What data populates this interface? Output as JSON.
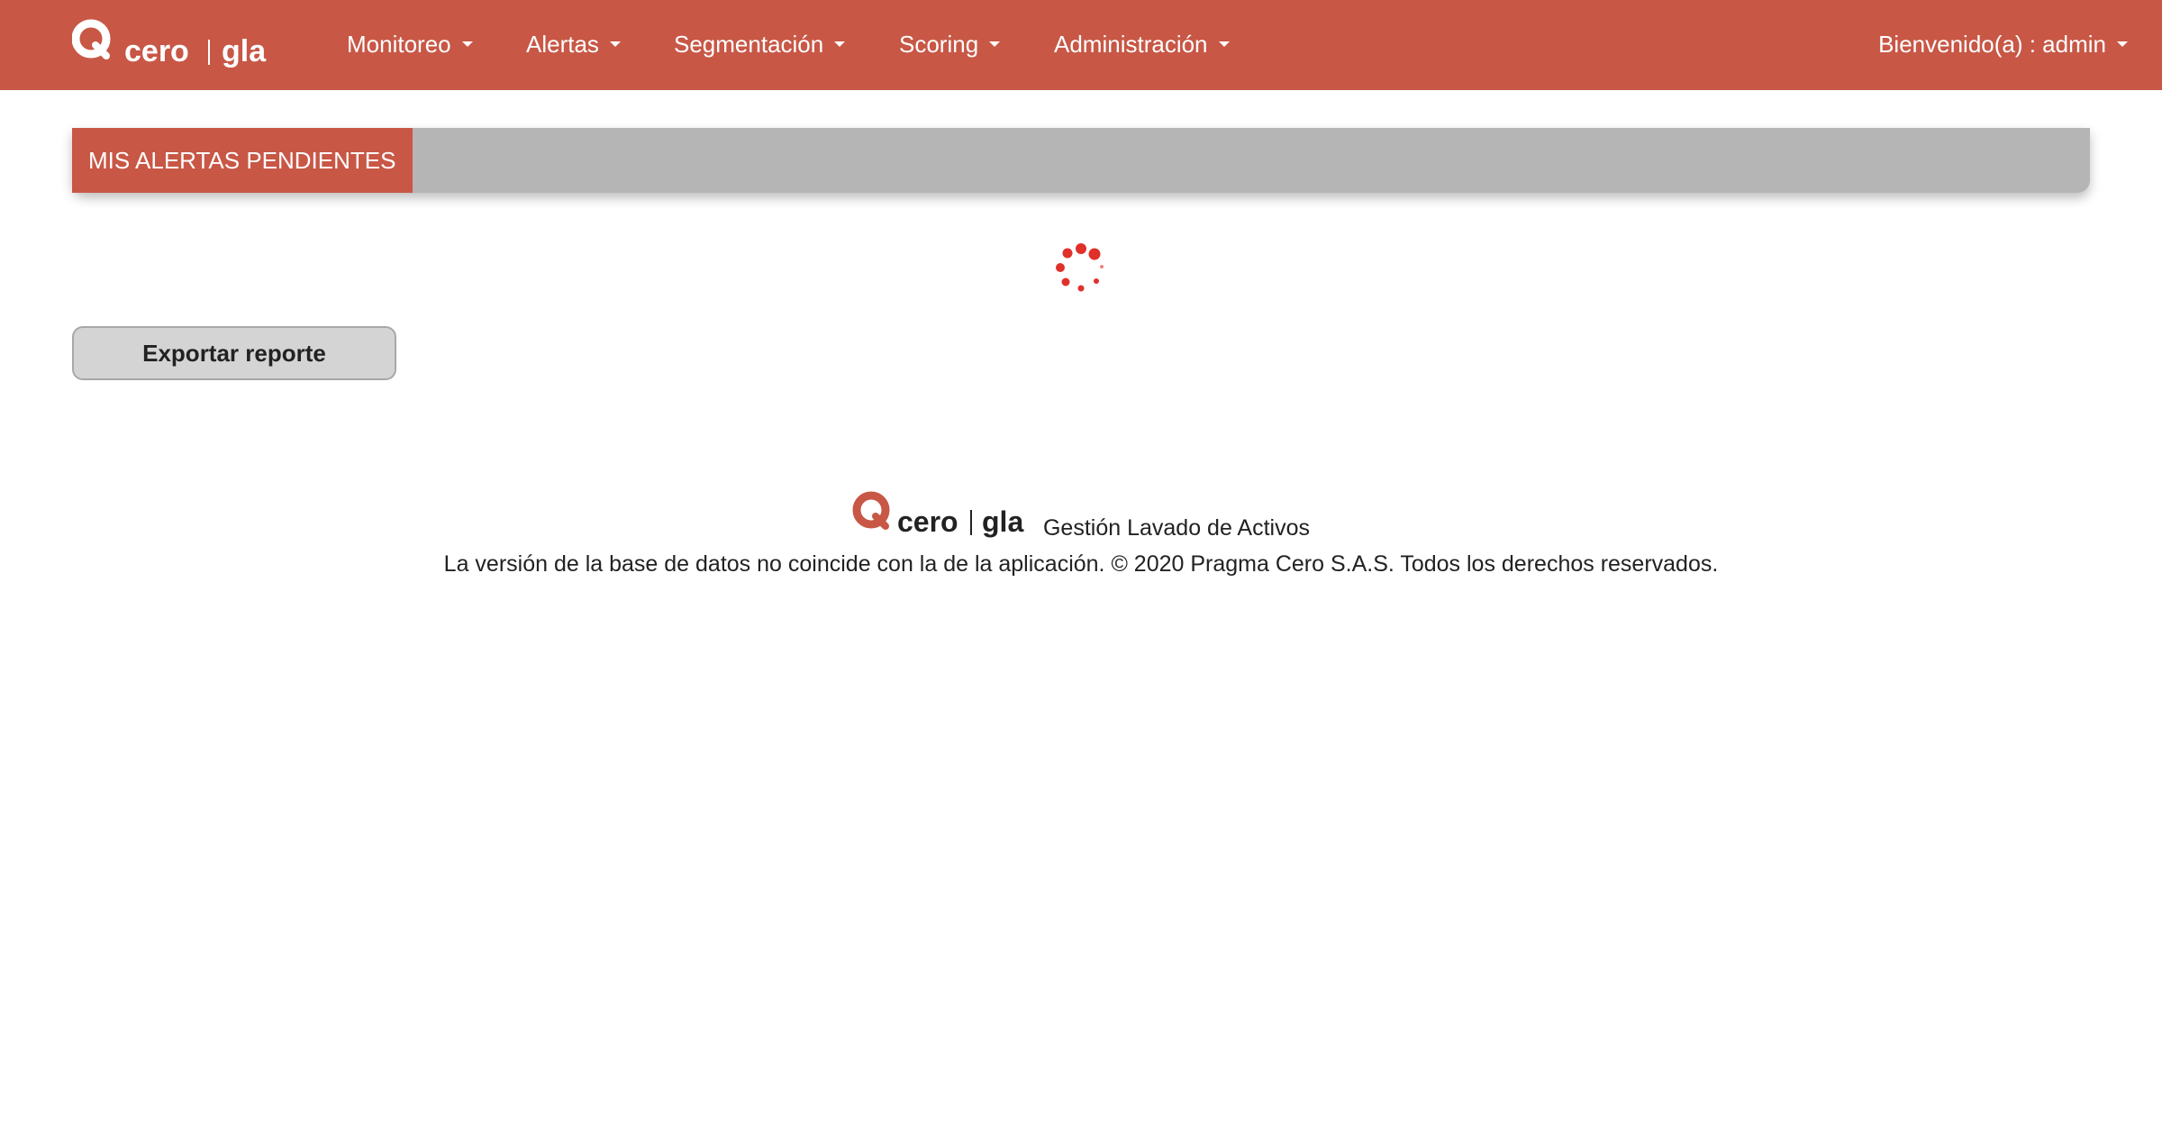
{
  "header": {
    "brand": {
      "logo_text": "cero",
      "logo_suffix": "gla",
      "logo_icon": "q-ring-logo"
    },
    "menu": [
      {
        "label": "Monitoreo",
        "icon": "caret-down-icon"
      },
      {
        "label": "Alertas",
        "icon": "caret-down-icon"
      },
      {
        "label": "Segmentación",
        "icon": "caret-down-icon"
      },
      {
        "label": "Scoring",
        "icon": "caret-down-icon"
      },
      {
        "label": "Administración",
        "icon": "caret-down-icon"
      }
    ],
    "user_menu": {
      "label": "Bienvenido(a) : admin",
      "icon": "caret-down-icon"
    }
  },
  "panel": {
    "tab_label": "MIS ALERTAS PENDIENTES"
  },
  "loading": {
    "icon": "loading-spinner-icon"
  },
  "actions": {
    "export_label": "Exportar reporte"
  },
  "footer": {
    "logo_text": "cero",
    "logo_suffix": "gla",
    "app_name": "Gestión Lavado de Activos",
    "copyright": "La versión de la base de datos no coincide con la de la aplicación. © 2020 Pragma Cero S.A.S. Todos los derechos reservados."
  },
  "colors": {
    "brand": "#c85746",
    "panel_bar": "#b5b5b5",
    "button_bg": "#d4d4d4",
    "spinner": "#e0302a"
  }
}
